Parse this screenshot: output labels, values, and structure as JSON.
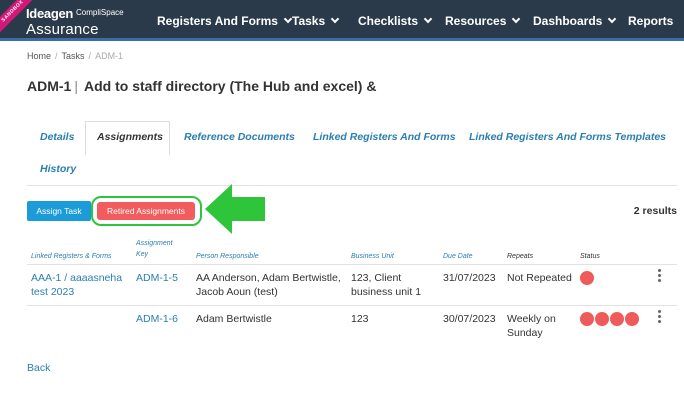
{
  "header": {
    "ribbon": "SANDBOX",
    "logo_brand": "Ideagen",
    "logo_sub": "CompliSpace",
    "logo_product": "Assurance",
    "nav": [
      {
        "label": "Registers And Forms",
        "dropdown": true
      },
      {
        "label": "Tasks",
        "dropdown": true
      },
      {
        "label": "Checklists",
        "dropdown": true
      },
      {
        "label": "Resources",
        "dropdown": true
      },
      {
        "label": "Dashboards",
        "dropdown": true
      },
      {
        "label": "Reports",
        "dropdown": false
      }
    ]
  },
  "breadcrumb": {
    "home": "Home",
    "tasks": "Tasks",
    "current": "ADM-1"
  },
  "title": {
    "key": "ADM-1",
    "separator": "|",
    "text": "Add to staff directory (The Hub and excel) &"
  },
  "tabs": [
    {
      "label": "Details",
      "active": false
    },
    {
      "label": "Assignments",
      "active": true
    },
    {
      "label": "Reference Documents",
      "active": false
    },
    {
      "label": "Linked Registers And Forms",
      "active": false
    },
    {
      "label": "Linked Registers And Forms Templates",
      "active": false
    },
    {
      "label": "History",
      "active": false
    }
  ],
  "toolbar": {
    "assign_label": "Assign Task",
    "retired_label": "Retired Assignments",
    "results": "2 results"
  },
  "table": {
    "headers": {
      "linked": "Linked Registers & Forms",
      "key_line1": "Assignment",
      "key_line2": "Key",
      "person": "Person Responsible",
      "unit": "Business Unit",
      "due": "Due Date",
      "repeats": "Repeats",
      "status": "Status"
    },
    "rows": [
      {
        "linked_line1": "AAA-1 / aaaasneha",
        "linked_line2": "test 2023",
        "key": "ADM-1-5",
        "person_line1": "AA Anderson, Adam Bertwistle,",
        "person_line2": "Jacob Aoun (test)",
        "unit_line1": "123, Client",
        "unit_line2": "business unit 1",
        "due": "31/07/2023",
        "repeats_line1": "Not Repeated",
        "repeats_line2": "",
        "status_count": 1
      },
      {
        "linked_line1": "",
        "linked_line2": "",
        "key": "ADM-1-6",
        "person_line1": "Adam Bertwistle",
        "person_line2": "",
        "unit_line1": "123",
        "unit_line2": "",
        "due": "30/07/2023",
        "repeats_line1": "Weekly on",
        "repeats_line2": "Sunday",
        "status_count": 4
      }
    ]
  },
  "footer": {
    "back_label": "Back"
  },
  "colors": {
    "nav_bg": "#2b3a4a",
    "link": "#2a7fb0",
    "assign_btn": "#1b9bd7",
    "retired_btn": "#f25c5c",
    "status_red": "#ef5a5a",
    "highlight_green": "#2ec53a"
  }
}
